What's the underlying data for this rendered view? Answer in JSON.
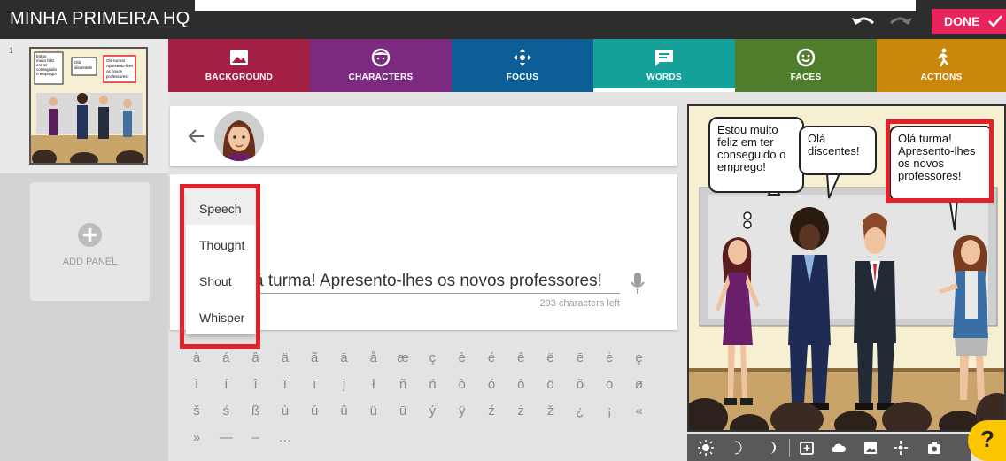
{
  "app": {
    "title": "MINHA PRIMEIRA HQ",
    "done_label": "DONE"
  },
  "panels": {
    "first_number": "1",
    "add_label": "ADD PANEL"
  },
  "tabs": [
    {
      "label": "BACKGROUND",
      "color": "#a31f43",
      "icon": "image-icon"
    },
    {
      "label": "CHARACTERS",
      "color": "#7b2a80",
      "icon": "character-icon"
    },
    {
      "label": "FOCUS",
      "color": "#0b5e96",
      "icon": "focus-icon"
    },
    {
      "label": "WORDS",
      "color": "#15a099",
      "icon": "speech-bubble-icon"
    },
    {
      "label": "FACES",
      "color": "#4f7d2b",
      "icon": "smiley-icon"
    },
    {
      "label": "ACTIONS",
      "color": "#c8870a",
      "icon": "running-person-icon"
    }
  ],
  "words": {
    "text_value": "Olá turma! Apresento-lhes os novos professores!",
    "chars_left": "293 characters left",
    "bubble_types": [
      "Speech",
      "Thought",
      "Shout",
      "Whisper"
    ],
    "selected_type": "Speech"
  },
  "special_chars": [
    [
      "à",
      "á",
      "â",
      "ä",
      "ã",
      "ā",
      "å",
      "æ",
      "ç",
      "è",
      "é",
      "ê",
      "ë",
      "ē",
      "ė",
      "ę"
    ],
    [
      "ì",
      "í",
      "î",
      "ï",
      "ī",
      "į",
      "ł",
      "ñ",
      "ń",
      "ò",
      "ó",
      "ô",
      "ö",
      "õ",
      "ō",
      "ø"
    ],
    [
      "š",
      "ś",
      "ß",
      "ù",
      "ú",
      "û",
      "ü",
      "ū",
      "ý",
      "ÿ",
      "ź",
      "ż",
      "ž",
      "¿",
      "¡",
      "«"
    ],
    [
      "»",
      "—",
      "–",
      "…"
    ]
  ],
  "comic": {
    "bubble1": "Estou muito feliz em ter conseguido o emprego!",
    "bubble2": "Olá discentes!",
    "bubble3": "Olá turma! Apresento-lhes os novos professores!",
    "thumb_bubble1": "Estou muito feliz em ter conseguido o emprego!",
    "thumb_bubble2": "Olá discentes!",
    "thumb_bubble3": "Olá turma! Apresento-lhes os novos professores!"
  },
  "help_label": "?",
  "toolbar_icons": [
    "brightness-icon",
    "half-moon-icon",
    "crescent-icon",
    "add-image-icon",
    "cloud-icon",
    "image-icon",
    "sparkle-icon",
    "camera-icon"
  ]
}
